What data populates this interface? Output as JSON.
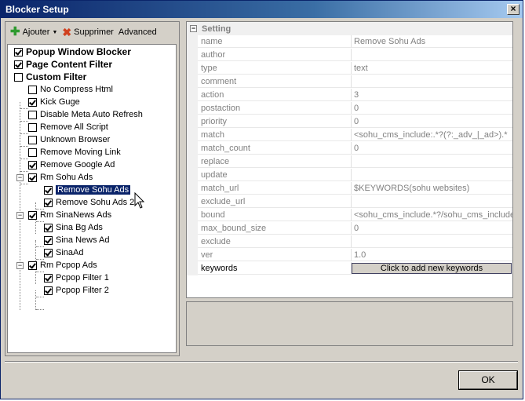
{
  "window": {
    "title": "Blocker Setup",
    "close_label": "×"
  },
  "toolbar": {
    "add_label": "Ajouter",
    "delete_label": "Supprimer",
    "advanced_label": "Advanced"
  },
  "tree": {
    "popup_blocker": {
      "label": "Popup Window Blocker",
      "checked": true
    },
    "page_content_filter": {
      "label": "Page Content Filter",
      "checked": true
    },
    "custom_filter": {
      "label": "Custom Filter",
      "checked": false
    },
    "no_compress_html": {
      "label": "No Compress Html",
      "checked": false
    },
    "kick_guge": {
      "label": "Kick Guge",
      "checked": true
    },
    "disable_meta_auto_refresh": {
      "label": "Disable Meta Auto Refresh",
      "checked": false
    },
    "remove_all_script": {
      "label": "Remove All Script",
      "checked": false
    },
    "unknown_browser": {
      "label": "Unknown Browser",
      "checked": false
    },
    "remove_moving_link": {
      "label": "Remove Moving Link",
      "checked": false
    },
    "remove_google_ad": {
      "label": "Remove Google Ad",
      "checked": true
    },
    "rm_sohu_ads": {
      "label": "Rm Sohu Ads",
      "checked": true
    },
    "remove_sohu_ads": {
      "label": "Remove Sohu Ads",
      "checked": true
    },
    "remove_sohu_ads_2": {
      "label": "Remove Sohu Ads 2",
      "checked": true
    },
    "rm_sinanews_ads": {
      "label": "Rm SinaNews Ads",
      "checked": true
    },
    "sina_bg_ads": {
      "label": "Sina Bg Ads",
      "checked": true
    },
    "sina_news_ad": {
      "label": "Sina News Ad",
      "checked": true
    },
    "sinaad": {
      "label": "SinaAd",
      "checked": true
    },
    "rm_pcpop_ads": {
      "label": "Rm Pcpop Ads",
      "checked": true
    },
    "pcpop_filter_1": {
      "label": "Pcpop Filter 1",
      "checked": true
    },
    "pcpop_filter_2": {
      "label": "Pcpop Filter 2",
      "checked": true
    }
  },
  "properties": {
    "category": "Setting",
    "rows": [
      {
        "name": "name",
        "value": "Remove Sohu Ads"
      },
      {
        "name": "author",
        "value": ""
      },
      {
        "name": "type",
        "value": "text"
      },
      {
        "name": "comment",
        "value": ""
      },
      {
        "name": "action",
        "value": "3"
      },
      {
        "name": "postaction",
        "value": "0"
      },
      {
        "name": "priority",
        "value": "0"
      },
      {
        "name": "match",
        "value": "<sohu_cms_include:.*?(?:_adv_|_ad>).*"
      },
      {
        "name": "match_count",
        "value": "0"
      },
      {
        "name": "replace",
        "value": ""
      },
      {
        "name": "update",
        "value": ""
      },
      {
        "name": "match_url",
        "value": "$KEYWORDS(sohu websites)"
      },
      {
        "name": "exclude_url",
        "value": ""
      },
      {
        "name": "bound",
        "value": "<sohu_cms_include.*?/sohu_cms_include>"
      },
      {
        "name": "max_bound_size",
        "value": "0"
      },
      {
        "name": "exclude",
        "value": ""
      },
      {
        "name": "ver",
        "value": "1.0"
      }
    ],
    "keywords_label": "keywords",
    "keywords_button": "Click to add new keywords"
  },
  "footer": {
    "ok_label": "OK"
  }
}
